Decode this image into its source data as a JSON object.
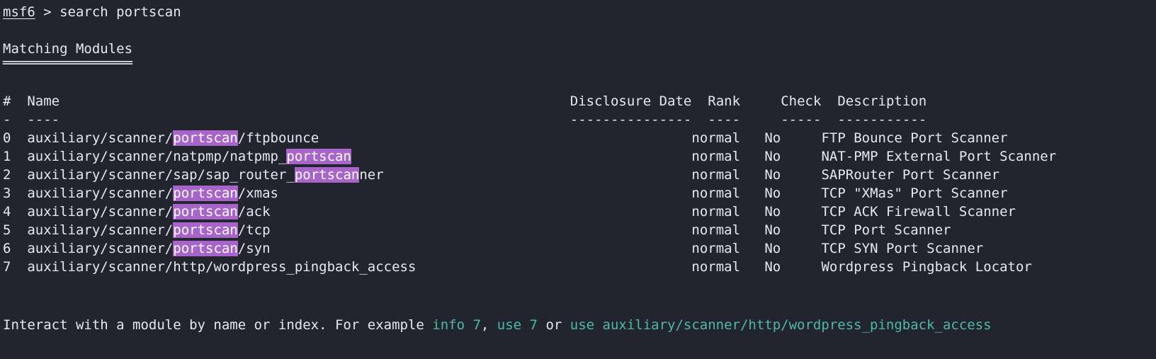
{
  "terminal": {
    "background_color": "#22252e",
    "foreground_color": "#e6e8ee",
    "highlight_color": "#a865c9",
    "accent_color": "#4fb9a8"
  },
  "prompt": {
    "host": "msf6",
    "symbol": " > ",
    "command": "search portscan"
  },
  "section": {
    "heading": "Matching Modules",
    "heading_rule": "════════════════"
  },
  "table": {
    "headers": {
      "index": "#",
      "name": "Name",
      "disclosure_date": "Disclosure Date",
      "rank": "Rank",
      "check": "Check",
      "description": "Description"
    },
    "rules": {
      "index": "-",
      "name": "----",
      "disclosure_date": "---------------",
      "rank": "----",
      "check": "-----",
      "description": "-----------"
    },
    "rows": [
      {
        "index": "0",
        "name_pre": "auxiliary/scanner/",
        "name_hl": "portscan",
        "name_post": "/ftpbounce",
        "disclosure_date": "",
        "rank": "normal",
        "check": "No",
        "description": "FTP Bounce Port Scanner"
      },
      {
        "index": "1",
        "name_pre": "auxiliary/scanner/natpmp/natpmp_",
        "name_hl": "portscan",
        "name_post": "",
        "disclosure_date": "",
        "rank": "normal",
        "check": "No",
        "description": "NAT-PMP External Port Scanner"
      },
      {
        "index": "2",
        "name_pre": "auxiliary/scanner/sap/sap_router_",
        "name_hl": "portscan",
        "name_post": "ner",
        "disclosure_date": "",
        "rank": "normal",
        "check": "No",
        "description": "SAPRouter Port Scanner"
      },
      {
        "index": "3",
        "name_pre": "auxiliary/scanner/",
        "name_hl": "portscan",
        "name_post": "/xmas",
        "disclosure_date": "",
        "rank": "normal",
        "check": "No",
        "description": "TCP \"XMas\" Port Scanner"
      },
      {
        "index": "4",
        "name_pre": "auxiliary/scanner/",
        "name_hl": "portscan",
        "name_post": "/ack",
        "disclosure_date": "",
        "rank": "normal",
        "check": "No",
        "description": "TCP ACK Firewall Scanner"
      },
      {
        "index": "5",
        "name_pre": "auxiliary/scanner/",
        "name_hl": "portscan",
        "name_post": "/tcp",
        "disclosure_date": "",
        "rank": "normal",
        "check": "No",
        "description": "TCP Port Scanner"
      },
      {
        "index": "6",
        "name_pre": "auxiliary/scanner/",
        "name_hl": "portscan",
        "name_post": "/syn",
        "disclosure_date": "",
        "rank": "normal",
        "check": "No",
        "description": "TCP SYN Port Scanner"
      },
      {
        "index": "7",
        "name_pre": "auxiliary/scanner/http/wordpress_pingback_access",
        "name_hl": "",
        "name_post": "",
        "disclosure_date": "",
        "rank": "normal",
        "check": "No",
        "description": "Wordpress Pingback Locator"
      }
    ]
  },
  "footer": {
    "text_1": "Interact with a module by name or index. For example ",
    "cmd_1": "info 7",
    "text_2": ", ",
    "cmd_2": "use 7",
    "text_3": " or ",
    "cmd_3": "use auxiliary/scanner/http/wordpress_pingback_access"
  }
}
